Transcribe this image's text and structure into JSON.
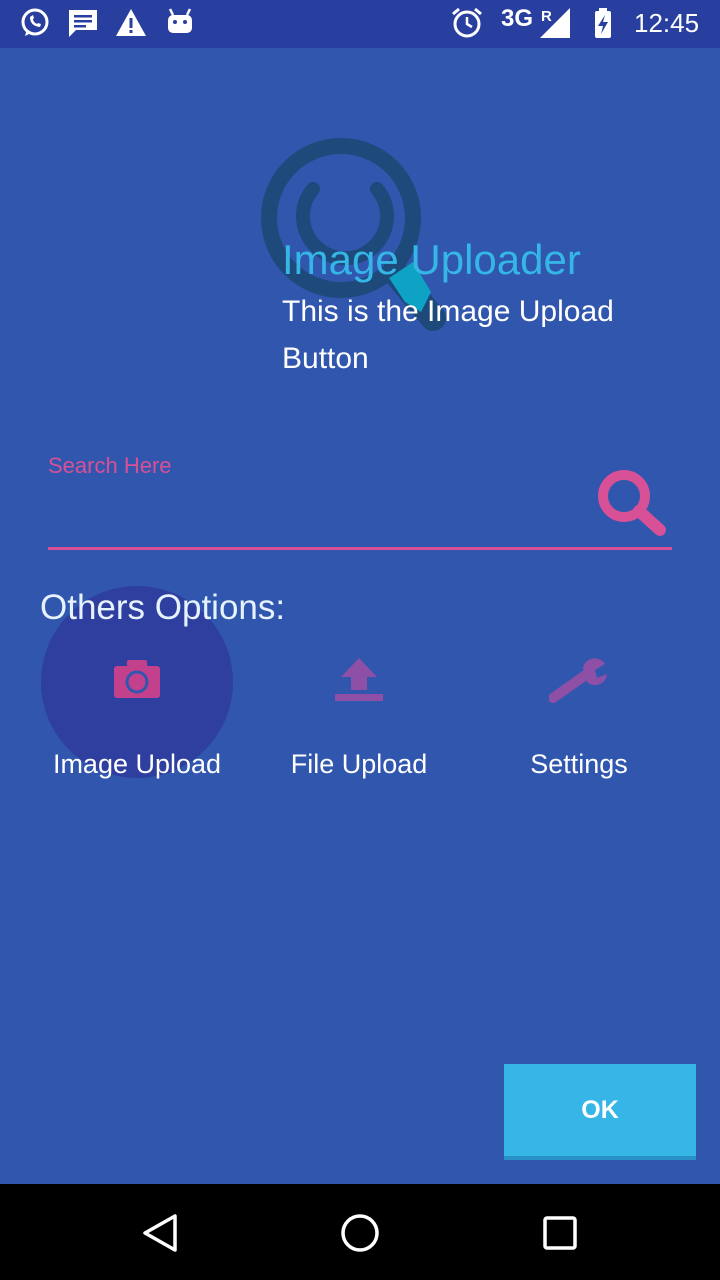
{
  "status_bar": {
    "network": "3G",
    "roaming": "R",
    "time": "12:45",
    "icons": [
      "whatsapp-icon",
      "message-icon",
      "warning-icon",
      "android-icon",
      "alarm-icon",
      "signal-icon",
      "battery-charging-icon"
    ]
  },
  "header": {
    "title": "Image Uploader",
    "description": "This is the Image Upload Button"
  },
  "search": {
    "label": "Search Here",
    "value": "",
    "placeholder": ""
  },
  "others": {
    "title": "Others Options:",
    "options": [
      {
        "label": "Image Upload",
        "icon": "camera-icon"
      },
      {
        "label": "File Upload",
        "icon": "upload-icon"
      },
      {
        "label": "Settings",
        "icon": "wrench-icon"
      }
    ]
  },
  "ok_button": {
    "label": "OK"
  },
  "nav_bar": {
    "icons": [
      "back-icon",
      "home-icon",
      "recents-icon"
    ]
  },
  "colors": {
    "background": "#3056ae",
    "status_bar": "#293f9f",
    "accent_pink": "#d85095",
    "accent_cyan": "#35b6e6",
    "icon_purple": "#8e4fa7"
  }
}
